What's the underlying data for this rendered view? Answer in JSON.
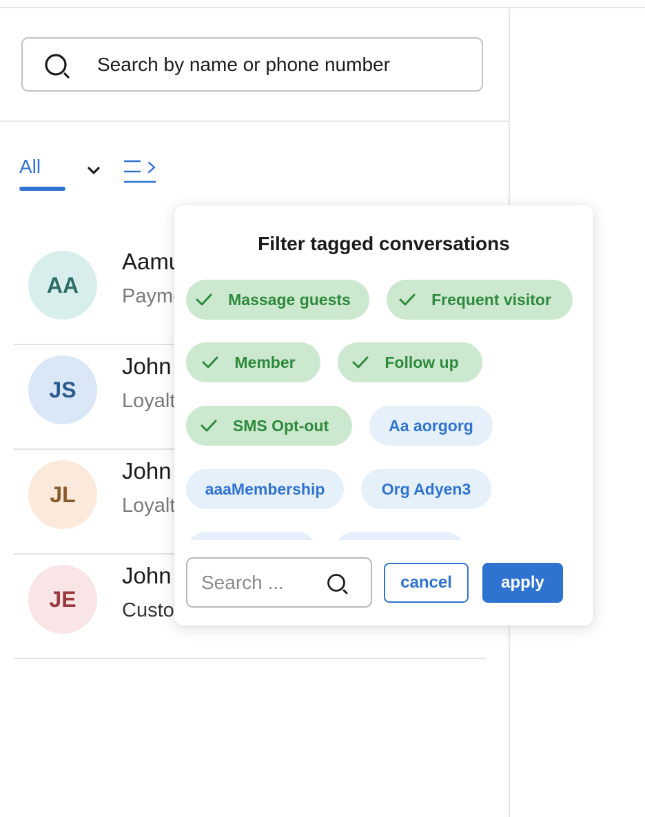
{
  "search": {
    "placeholder": "Search by name or phone number"
  },
  "tabs": {
    "active_label": "All"
  },
  "icons": {
    "search": "search-icon",
    "dropdown": "chevron-down-icon",
    "filter": "filter-list-icon",
    "check": "check-icon"
  },
  "colors": {
    "accent": "#2f73d0",
    "tag_selected_bg": "#cce8cf",
    "tag_selected_text": "#2e8a3c",
    "tag_unselected_bg": "#e6f0fb"
  },
  "contacts": [
    {
      "initials": "AA",
      "name": "Aamu",
      "subtitle": "Payme",
      "avatar_bg": "#d8eeed",
      "avatar_fg": "#2f6d6a"
    },
    {
      "initials": "JS",
      "name": "John",
      "subtitle": "Loyalt",
      "avatar_bg": "#d9e7f6",
      "avatar_fg": "#2d5a8c"
    },
    {
      "initials": "JL",
      "name": "John",
      "subtitle": "Loyalt",
      "avatar_bg": "#fbeadc",
      "avatar_fg": "#8a5a2b"
    },
    {
      "initials": "JE",
      "name": "John",
      "subtitle": "Custo",
      "avatar_bg": "#f9e4e6",
      "avatar_fg": "#9a3a3f"
    }
  ],
  "filter_popover": {
    "title": "Filter tagged conversations",
    "tags": [
      {
        "label": "Massage guests",
        "selected": true
      },
      {
        "label": "Frequent visitor",
        "selected": true
      },
      {
        "label": "Member",
        "selected": true
      },
      {
        "label": "Follow up",
        "selected": true
      },
      {
        "label": "SMS Opt-out",
        "selected": true
      },
      {
        "label": "Aa aorgorg",
        "selected": false
      },
      {
        "label": "aaaMembership",
        "selected": false
      },
      {
        "label": "Org Adyen3",
        "selected": false
      }
    ],
    "search_placeholder": "Search ...",
    "cancel_label": "cancel",
    "apply_label": "apply"
  }
}
